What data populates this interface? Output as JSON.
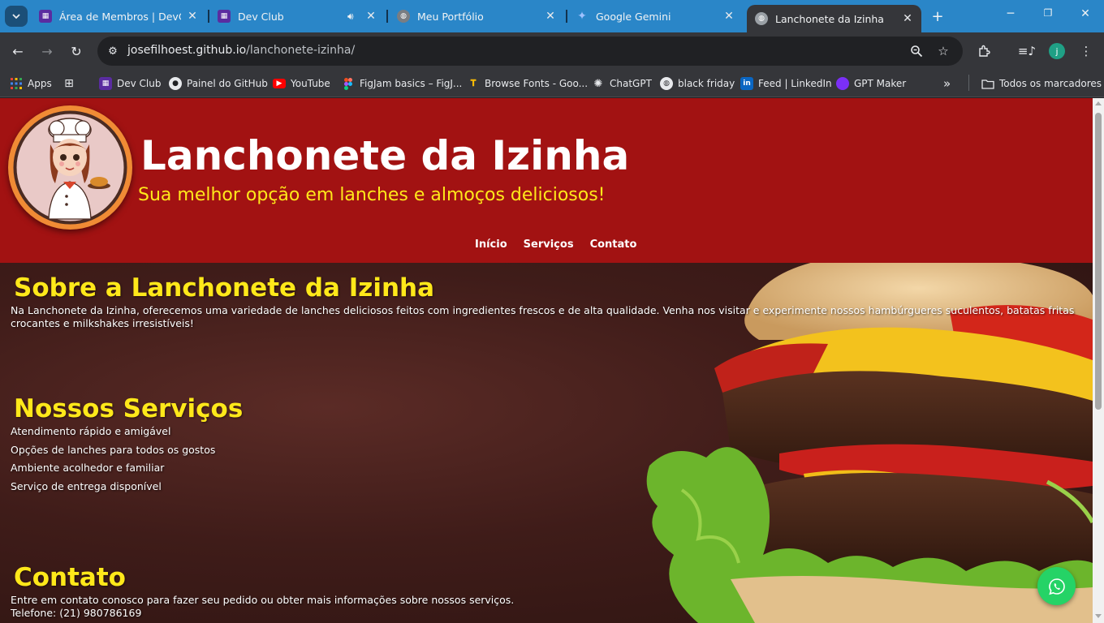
{
  "browser": {
    "tabs": [
      {
        "title": "Área de Membros | DevClub",
        "icon": "devclub-icon"
      },
      {
        "title": "Dev Club",
        "icon": "devclub-icon",
        "audio": true
      },
      {
        "title": "Meu Portfólio",
        "icon": "globe-icon"
      },
      {
        "title": "Google Gemini",
        "icon": "gemini-icon"
      },
      {
        "title": "Lanchonete da Izinha",
        "icon": "globe-icon",
        "active": true
      }
    ],
    "url_host": "josefilhoest.github.io",
    "url_path": "/lanchonete-izinha/",
    "profile_initial": "j",
    "bookmarks": [
      {
        "label": "Apps",
        "icon": "apps-grid-icon"
      },
      {
        "label": "",
        "icon": "tab-groups-icon"
      },
      {
        "label": "Dev Club",
        "icon": "devclub-icon"
      },
      {
        "label": "Painel do GitHub",
        "icon": "github-icon"
      },
      {
        "label": "YouTube",
        "icon": "youtube-icon"
      },
      {
        "label": "FigJam basics – FigJ...",
        "icon": "figma-icon"
      },
      {
        "label": "Browse Fonts - Goo...",
        "icon": "google-fonts-icon"
      },
      {
        "label": "ChatGPT",
        "icon": "chatgpt-icon"
      },
      {
        "label": "black friday",
        "icon": "globe-icon"
      },
      {
        "label": "Feed | LinkedIn",
        "icon": "linkedin-icon"
      },
      {
        "label": "GPT Maker",
        "icon": "gptmaker-icon"
      }
    ],
    "all_bookmarks": "Todos os marcadores"
  },
  "site": {
    "title": "Lanchonete da Izinha",
    "subtitle": "Sua melhor opção em lanches e almoços deliciosos!",
    "nav": [
      "Início",
      "Serviços",
      "Contato"
    ],
    "about": {
      "title": "Sobre a Lanchonete da Izinha",
      "text": "Na Lanchonete da Izinha, oferecemos uma variedade de lanches deliciosos feitos com ingredientes frescos e de alta qualidade. Venha nos visitar e experimente nossos hambúrgueres suculentos, batatas fritas crocantes e milkshakes irresistíveis!"
    },
    "services": {
      "title": "Nossos Serviços",
      "items": [
        "Atendimento rápido e amigável",
        "Opções de lanches para todos os gostos",
        "Ambiente acolhedor e familiar",
        "Serviço de entrega disponível"
      ]
    },
    "contact": {
      "title": "Contato",
      "text": "Entre em contato conosco para fazer seu pedido ou obter mais informações sobre nossos serviços.",
      "phone": "Telefone: (21) 980786169"
    }
  },
  "colors": {
    "header_red": "#a21212",
    "accent_yellow": "#ffe81a",
    "whatsapp_green": "#25d366",
    "tabbar_blue": "#2a86c8"
  }
}
